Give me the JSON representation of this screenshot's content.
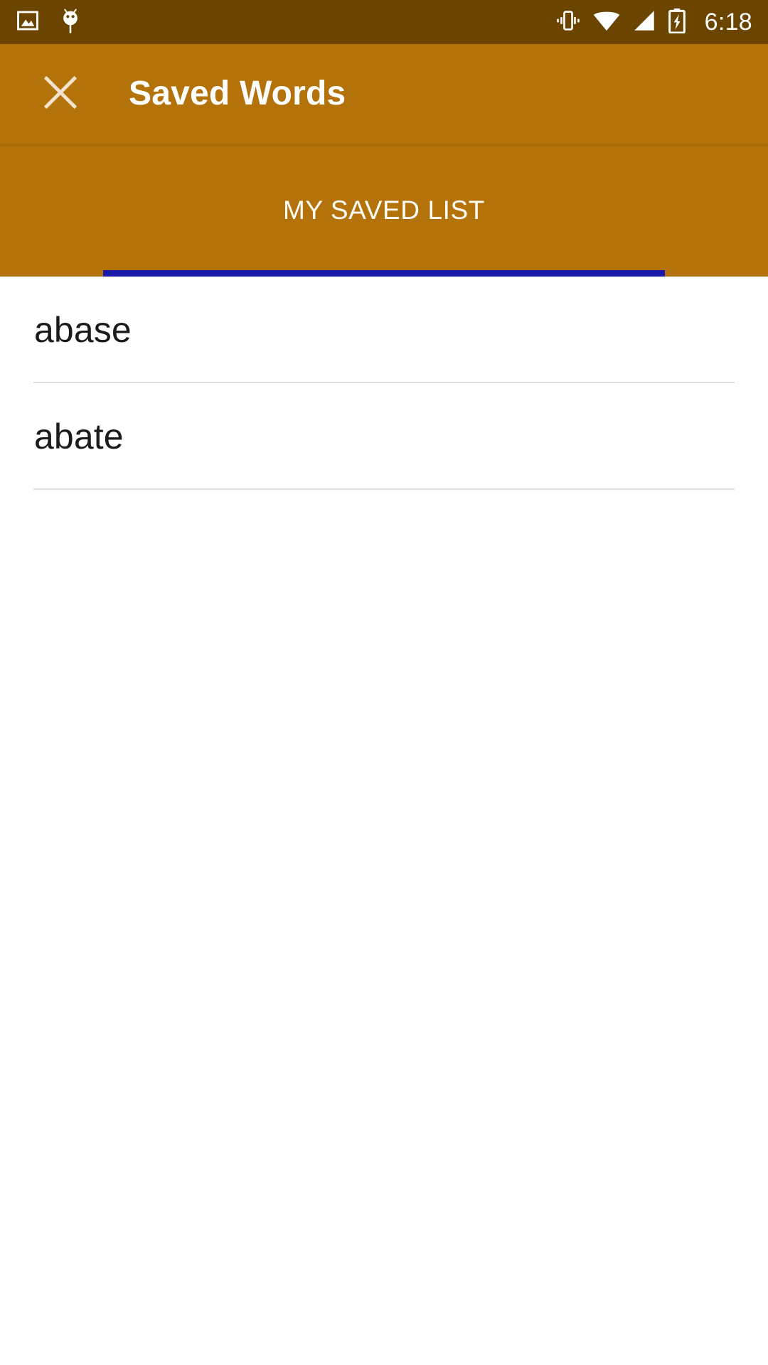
{
  "status_bar": {
    "background_color": "#6B4500",
    "clock": "6:18",
    "left_icons": [
      "image-icon",
      "android-debug-icon"
    ],
    "right_icons": [
      "vibrate-icon",
      "wifi-icon",
      "cell-signal-icon",
      "battery-charging-icon"
    ]
  },
  "app_bar": {
    "background_color": "#B4730A",
    "close_label": "close-icon",
    "title": "Saved Words"
  },
  "tabs": {
    "background_color": "#B4730A",
    "indicator_color": "#1A1AA8",
    "items": [
      {
        "label": "MY SAVED LIST",
        "selected": true
      }
    ]
  },
  "list": {
    "items": [
      {
        "word": "abase"
      },
      {
        "word": "abate"
      }
    ]
  }
}
